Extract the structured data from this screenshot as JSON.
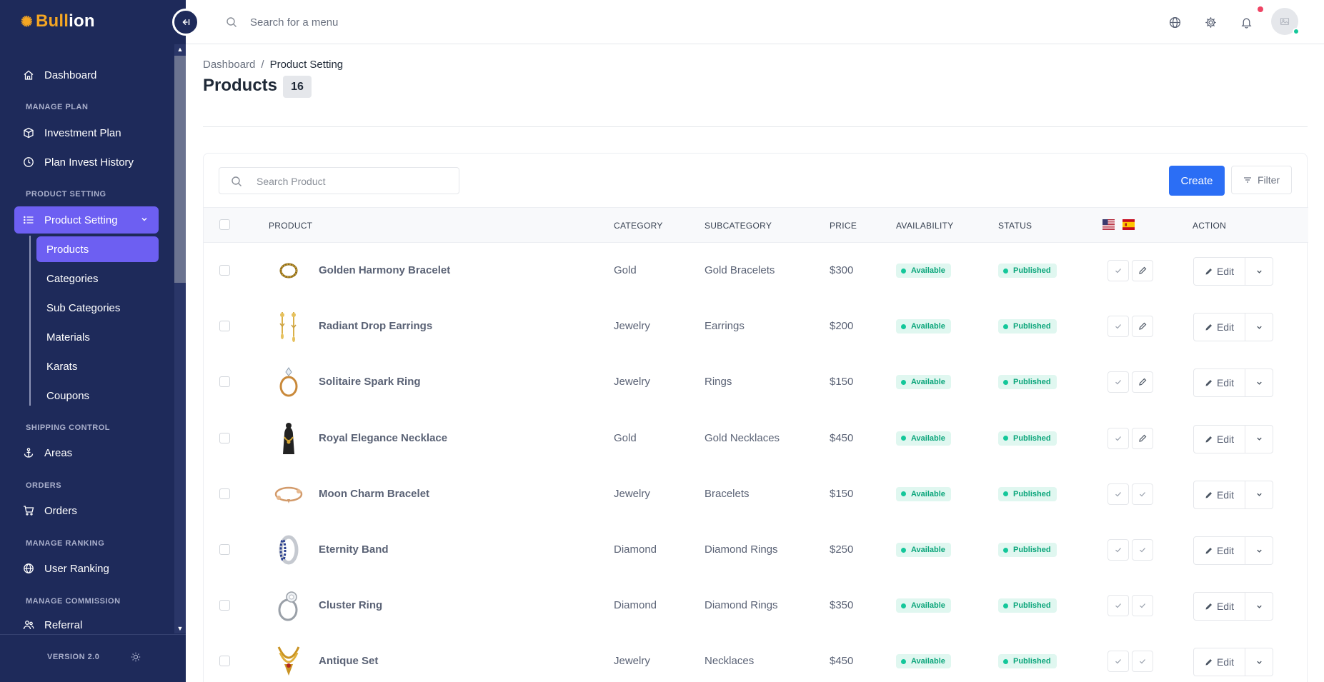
{
  "app": {
    "logo_part1": "Bull",
    "logo_part2": "ion"
  },
  "sidebar": {
    "dashboard": "Dashboard",
    "sections": {
      "manage_plan": "MANAGE PLAN",
      "product_setting": "PRODUCT SETTING",
      "shipping_control": "SHIPPING CONTROL",
      "orders": "ORDERS",
      "manage_ranking": "MANAGE RANKING",
      "manage_commission": "MANAGE COMMISSION"
    },
    "items": {
      "investment_plan": "Investment Plan",
      "plan_invest_history": "Plan Invest History",
      "product_setting": "Product Setting",
      "areas": "Areas",
      "orders": "Orders",
      "user_ranking": "User Ranking",
      "referral": "Referral"
    },
    "sub_items": [
      "Products",
      "Categories",
      "Sub Categories",
      "Materials",
      "Karats",
      "Coupons"
    ],
    "version": "VERSION 2.0"
  },
  "topbar": {
    "search_placeholder": "Search for a menu"
  },
  "breadcrumb": {
    "root": "Dashboard",
    "sep": "/",
    "current": "Product Setting"
  },
  "page": {
    "title": "Products",
    "count": "16"
  },
  "toolbar": {
    "search_placeholder": "Search Product",
    "create_label": "Create",
    "filter_label": "Filter"
  },
  "table": {
    "headers": {
      "product": "PRODUCT",
      "category": "CATEGORY",
      "subcategory": "SUBCATEGORY",
      "price": "PRICE",
      "availability": "AVAILABILITY",
      "status": "STATUS",
      "action": "ACTION"
    },
    "edit_label": "Edit",
    "rows": [
      {
        "name": "Golden Harmony Bracelet",
        "category": "Gold",
        "subcategory": "Gold Bracelets",
        "price": "$300",
        "availability": "Available",
        "status": "Published",
        "lang_icons": [
          "check-icon",
          "pencil-icon"
        ],
        "thumb": "bracelet"
      },
      {
        "name": "Radiant Drop Earrings",
        "category": "Jewelry",
        "subcategory": "Earrings",
        "price": "$200",
        "availability": "Available",
        "status": "Published",
        "lang_icons": [
          "check-icon",
          "pencil-icon"
        ],
        "thumb": "earrings"
      },
      {
        "name": "Solitaire Spark Ring",
        "category": "Jewelry",
        "subcategory": "Rings",
        "price": "$150",
        "availability": "Available",
        "status": "Published",
        "lang_icons": [
          "check-icon",
          "pencil-icon"
        ],
        "thumb": "ring-gold"
      },
      {
        "name": "Royal Elegance Necklace",
        "category": "Gold",
        "subcategory": "Gold Necklaces",
        "price": "$450",
        "availability": "Available",
        "status": "Published",
        "lang_icons": [
          "check-icon",
          "pencil-icon"
        ],
        "thumb": "necklace-bust"
      },
      {
        "name": "Moon Charm Bracelet",
        "category": "Jewelry",
        "subcategory": "Bracelets",
        "price": "$150",
        "availability": "Available",
        "status": "Published",
        "lang_icons": [
          "check-icon",
          "check-icon"
        ],
        "thumb": "charm-bracelet"
      },
      {
        "name": "Eternity Band",
        "category": "Diamond",
        "subcategory": "Diamond Rings",
        "price": "$250",
        "availability": "Available",
        "status": "Published",
        "lang_icons": [
          "check-icon",
          "check-icon"
        ],
        "thumb": "band"
      },
      {
        "name": "Cluster Ring",
        "category": "Diamond",
        "subcategory": "Diamond Rings",
        "price": "$350",
        "availability": "Available",
        "status": "Published",
        "lang_icons": [
          "check-icon",
          "check-icon"
        ],
        "thumb": "ring-silver"
      },
      {
        "name": "Antique Set",
        "category": "Jewelry",
        "subcategory": "Necklaces",
        "price": "$450",
        "availability": "Available",
        "status": "Published",
        "lang_icons": [
          "check-icon",
          "check-icon"
        ],
        "thumb": "antique-necklace"
      }
    ]
  },
  "colors": {
    "sidebar_bg": "#1e2a5a",
    "accent": "#6d5ff2",
    "primary_button": "#2b6ef5",
    "logo_gold": "#f5a623",
    "success": "#14c79a"
  }
}
